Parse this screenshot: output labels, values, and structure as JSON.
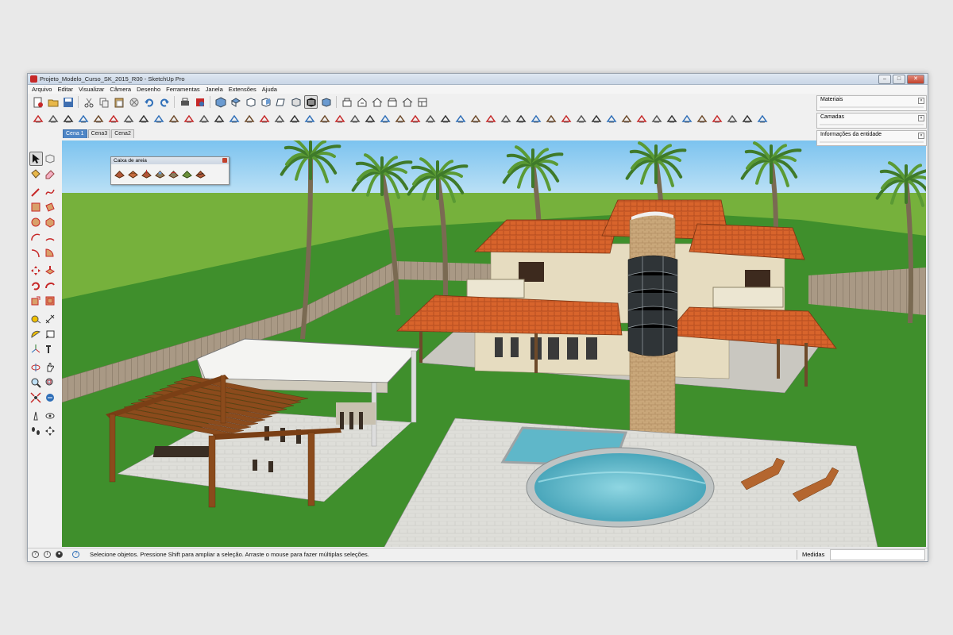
{
  "window": {
    "title": "Projeto_Modelo_Curso_SK_2015_R00 - SketchUp Pro",
    "controls": [
      "–",
      "□",
      "✕"
    ]
  },
  "menu": [
    "Arquivo",
    "Editar",
    "Visualizar",
    "Câmera",
    "Desenho",
    "Ferramentas",
    "Janela",
    "Extensões",
    "Ajuda"
  ],
  "scene_tabs": [
    {
      "label": "Cena 1",
      "active": true
    },
    {
      "label": "Cena3",
      "active": false
    },
    {
      "label": "Cena2",
      "active": false
    }
  ],
  "sandbox_toolbar": {
    "title": "Caixa de areia",
    "icons": [
      "from-contours-icon",
      "from-scratch-icon",
      "smoove-icon",
      "stamp-icon",
      "drape-icon",
      "add-detail-icon",
      "flip-edge-icon"
    ]
  },
  "trays": [
    {
      "label": "Materiais"
    },
    {
      "label": "Camadas"
    },
    {
      "label": "Informações da entidade"
    }
  ],
  "status": {
    "message": "Selecione objetos. Pressione Shift para ampliar a seleção. Arraste o mouse para fazer múltiplas seleções.",
    "measure_label": "Medidas",
    "measure_value": ""
  },
  "colors": {
    "sky": "#8ccbef",
    "grass": "#3f8f2c",
    "roof": "#d8642c",
    "wall": "#e6dcc0",
    "pool_water": "#5fb7c9",
    "paving": "#dcdcd8",
    "wood": "#8b4b1c"
  }
}
